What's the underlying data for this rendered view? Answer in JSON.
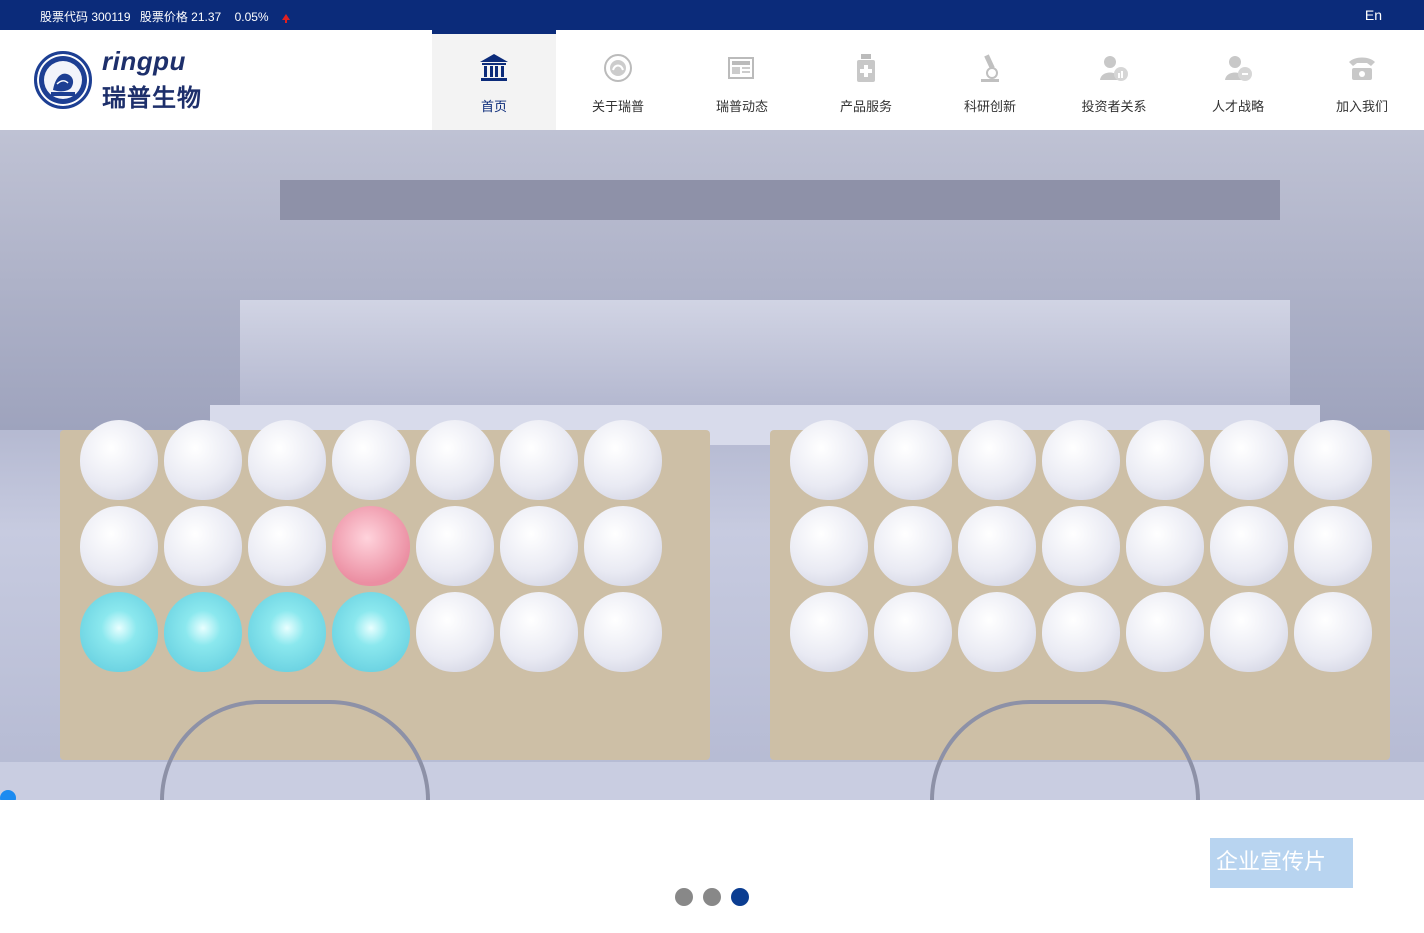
{
  "topbar": {
    "stock_code_label": "股票代码 300119",
    "stock_price_label": "股票价格 21.37",
    "stock_change": "0.05%",
    "change_direction": "up",
    "lang_switch": "En"
  },
  "header": {
    "brand": "ringpu",
    "brand_cn": "瑞普生物"
  },
  "nav": {
    "items": [
      {
        "label": "首页",
        "icon": "bank-icon",
        "active": true
      },
      {
        "label": "关于瑞普",
        "icon": "emblem-icon",
        "active": false
      },
      {
        "label": "瑞普动态",
        "icon": "news-icon",
        "active": false
      },
      {
        "label": "产品服务",
        "icon": "medicine-bottle-icon",
        "active": false
      },
      {
        "label": "科研创新",
        "icon": "microscope-icon",
        "active": false
      },
      {
        "label": "投资者关系",
        "icon": "investor-icon",
        "active": false
      },
      {
        "label": "人才战略",
        "icon": "recruit-icon",
        "active": false
      },
      {
        "label": "加入我们",
        "icon": "telephone-icon",
        "active": false
      }
    ]
  },
  "hero": {
    "media": "production-line-eggs-video"
  },
  "promo": {
    "label": "企业宣传片"
  },
  "carousel": {
    "count": 3,
    "active_index": 2
  },
  "colors": {
    "primary": "#0b2b7a",
    "nav_active_bg": "#f3f3f3",
    "promo_bg": "#b8d4f0",
    "dot_inactive": "#888888",
    "dot_active": "#0b3d91",
    "stock_up": "#e02020"
  }
}
